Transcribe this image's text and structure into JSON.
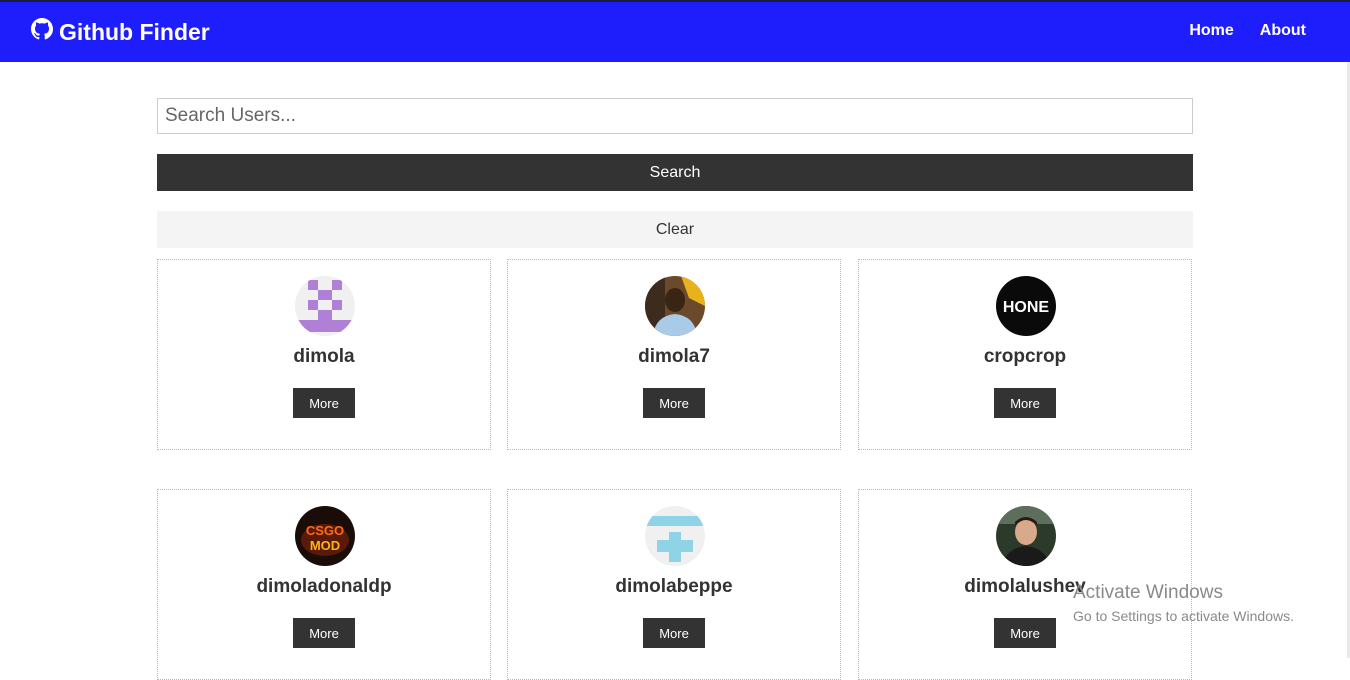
{
  "navbar": {
    "brand": "Github Finder",
    "brand_icon": "github-icon",
    "links": [
      {
        "label": "Home"
      },
      {
        "label": "About"
      }
    ],
    "color": "#1e1efc"
  },
  "search": {
    "placeholder": "Search Users...",
    "value": "",
    "search_label": "Search",
    "clear_label": "Clear"
  },
  "users": [
    {
      "login": "dimola",
      "more_label": "More",
      "avatar": "purple-identicon"
    },
    {
      "login": "dimola7",
      "more_label": "More",
      "avatar": "photo-man-yellow-sign"
    },
    {
      "login": "cropcrop",
      "more_label": "More",
      "avatar": "hone-logo"
    },
    {
      "login": "dimoladonaldp",
      "more_label": "More",
      "avatar": "csgo-mod-logo"
    },
    {
      "login": "dimolabeppe",
      "more_label": "More",
      "avatar": "blue-identicon"
    },
    {
      "login": "dimolalushev",
      "more_label": "More",
      "avatar": "photo-man-car"
    }
  ],
  "watermark": {
    "title": "Activate Windows",
    "subtitle": "Go to Settings to activate Windows."
  }
}
